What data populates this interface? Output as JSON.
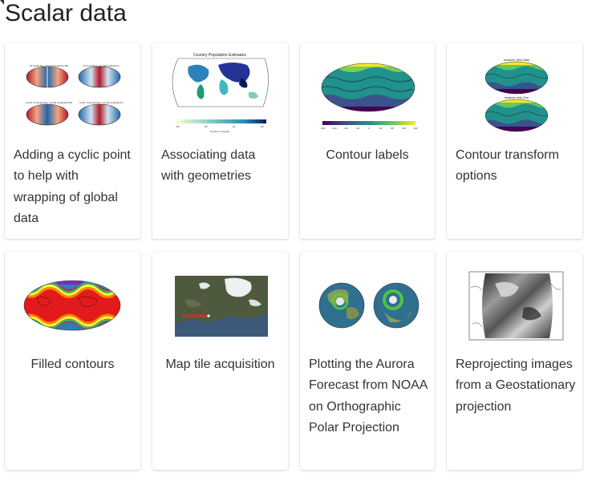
{
  "page": {
    "title": "Scalar data"
  },
  "cards": [
    {
      "label": "Adding a cyclic point to help with wrapping of global data",
      "thumb": "cyclic-point-maps"
    },
    {
      "label": "Associating data with geometries",
      "thumb": "country-population-map",
      "thumb_text": {
        "title": "Country Population Estimates",
        "colorbar_label": "Number of people",
        "ticks": [
          "10⁵",
          "10⁶",
          "10⁷",
          "10⁸"
        ]
      }
    },
    {
      "label": "Contour labels",
      "thumb": "contour-labels-map",
      "thumb_text": {
        "ticks": [
          "−160",
          "−120",
          "−80",
          "−40",
          "0",
          "40",
          "80",
          "120",
          "160"
        ]
      }
    },
    {
      "label": "Contour transform options",
      "thumb": "contour-transform-maps",
      "thumb_text": {
        "top": "transform_first=False",
        "bottom": "transform_first=True"
      }
    },
    {
      "label": "Filled contours",
      "thumb": "filled-contours-map"
    },
    {
      "label": "Map tile acquisition",
      "thumb": "map-tile-satellite"
    },
    {
      "label": "Plotting the Aurora Forecast from NOAA on Orthographic Polar Projection",
      "thumb": "aurora-polar-globes"
    },
    {
      "label": "Reprojecting images from a Geostationary projection",
      "thumb": "geostationary-image-map"
    }
  ],
  "colors": {
    "card_bg": "#ffffff",
    "text": "#333333",
    "heading": "#222222",
    "ocean": "#2a7a8c",
    "viridis_dark": "#440154",
    "viridis_mid": "#21918c",
    "viridis_light": "#fde725"
  }
}
